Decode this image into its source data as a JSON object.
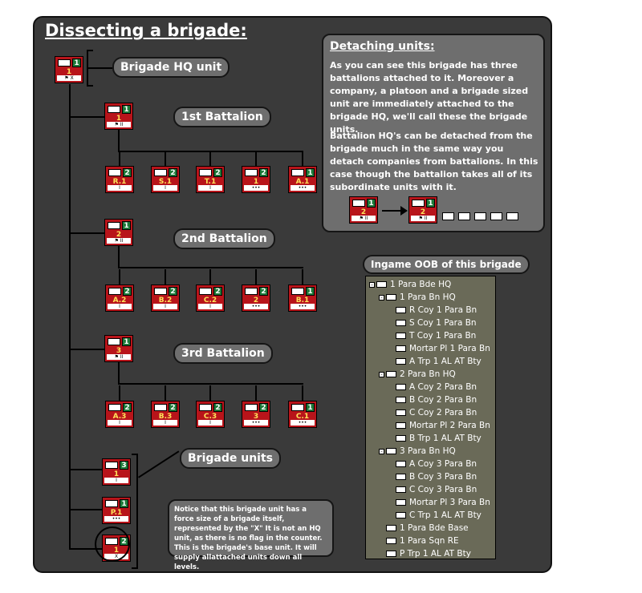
{
  "title": "Dissecting a brigade:",
  "labels": {
    "brigade_hq": "Brigade HQ unit",
    "bn1": "1st Battalion",
    "bn2": "2nd Battalion",
    "bn3": "3rd Battalion",
    "brigade_units": "Brigade units"
  },
  "counters": {
    "hq": {
      "num": "1",
      "label": "1"
    },
    "bn1": {
      "num": "1",
      "label": "1"
    },
    "bn2": {
      "num": "1",
      "label": "2"
    },
    "bn3": {
      "num": "1",
      "label": "3"
    },
    "bn1_subs": [
      {
        "num": "2",
        "label": "R.1"
      },
      {
        "num": "2",
        "label": "S.1"
      },
      {
        "num": "2",
        "label": "T.1"
      },
      {
        "num": "2",
        "label": "1"
      },
      {
        "num": "1",
        "label": "A.1"
      }
    ],
    "bn2_subs": [
      {
        "num": "2",
        "label": "A.2"
      },
      {
        "num": "2",
        "label": "B.2"
      },
      {
        "num": "2",
        "label": "C.2"
      },
      {
        "num": "2",
        "label": "2"
      },
      {
        "num": "1",
        "label": "B.1"
      }
    ],
    "bn3_subs": [
      {
        "num": "2",
        "label": "A.3"
      },
      {
        "num": "2",
        "label": "B.3"
      },
      {
        "num": "2",
        "label": "C.3"
      },
      {
        "num": "2",
        "label": "3"
      },
      {
        "num": "1",
        "label": "C.1"
      }
    ],
    "brigade_units": [
      {
        "num": "3",
        "label": "1"
      },
      {
        "num": "1",
        "label": "P.1"
      },
      {
        "num": "2",
        "label": "1"
      }
    ],
    "detach_example": [
      {
        "num": "1",
        "label": "2"
      },
      {
        "num": "1",
        "label": "2"
      }
    ]
  },
  "detach": {
    "heading": "Detaching units:",
    "p1": "As you can see this brigade has three battalions attached to it. Moreover a company, a platoon and a brigade sized unit are immediately attached to the brigade HQ, we'll call these the brigade units.",
    "p2": "Battalion HQ's can be detached from the brigade much in the same way you detach companies from battalions. In this case though the battalion takes all of its subordinate units with it."
  },
  "oob": {
    "title": "Ingame OOB of this brigade",
    "rows": [
      {
        "indent": 0,
        "toggle": "-",
        "text": "1 Para Bde HQ"
      },
      {
        "indent": 1,
        "toggle": "-",
        "text": "1 Para Bn HQ"
      },
      {
        "indent": 2,
        "toggle": "",
        "text": "R Coy 1 Para Bn"
      },
      {
        "indent": 2,
        "toggle": "",
        "text": "S Coy 1 Para Bn"
      },
      {
        "indent": 2,
        "toggle": "",
        "text": "T Coy 1 Para Bn"
      },
      {
        "indent": 2,
        "toggle": "",
        "text": "Mortar Pl 1 Para Bn"
      },
      {
        "indent": 2,
        "toggle": "",
        "text": "A Trp 1 AL AT Bty"
      },
      {
        "indent": 1,
        "toggle": "-",
        "text": "2 Para Bn HQ"
      },
      {
        "indent": 2,
        "toggle": "",
        "text": "A Coy 2 Para Bn"
      },
      {
        "indent": 2,
        "toggle": "",
        "text": "B Coy 2 Para Bn"
      },
      {
        "indent": 2,
        "toggle": "",
        "text": "C Coy 2 Para Bn"
      },
      {
        "indent": 2,
        "toggle": "",
        "text": "Mortar Pl 2 Para Bn"
      },
      {
        "indent": 2,
        "toggle": "",
        "text": "B Trp 1 AL AT Bty"
      },
      {
        "indent": 1,
        "toggle": "-",
        "text": "3 Para Bn HQ"
      },
      {
        "indent": 2,
        "toggle": "",
        "text": "A Coy 3 Para Bn"
      },
      {
        "indent": 2,
        "toggle": "",
        "text": "B Coy 3 Para Bn"
      },
      {
        "indent": 2,
        "toggle": "",
        "text": "C Coy 3 Para Bn"
      },
      {
        "indent": 2,
        "toggle": "",
        "text": "Mortar Pl 3 Para Bn"
      },
      {
        "indent": 2,
        "toggle": "",
        "text": "C Trp 1 AL AT Bty"
      },
      {
        "indent": 1,
        "toggle": "",
        "text": "1 Para Bde Base"
      },
      {
        "indent": 1,
        "toggle": "",
        "text": "1 Para Sqn RE"
      },
      {
        "indent": 1,
        "toggle": "",
        "text": "P Trp 1 AL AT Bty"
      }
    ]
  },
  "note": "Notice that this brigade unit has a force size of a brigade itself, represented by the \"X\" It is not an HQ unit, as there is no flag in the counter. This  is the brigade's base unit. It will supply allattached units down all levels.",
  "colors": {
    "counter_red": "#b8141a",
    "counter_green": "#1e7a3a",
    "panel": "#3a3a3a",
    "box": "#6e6e6e"
  }
}
